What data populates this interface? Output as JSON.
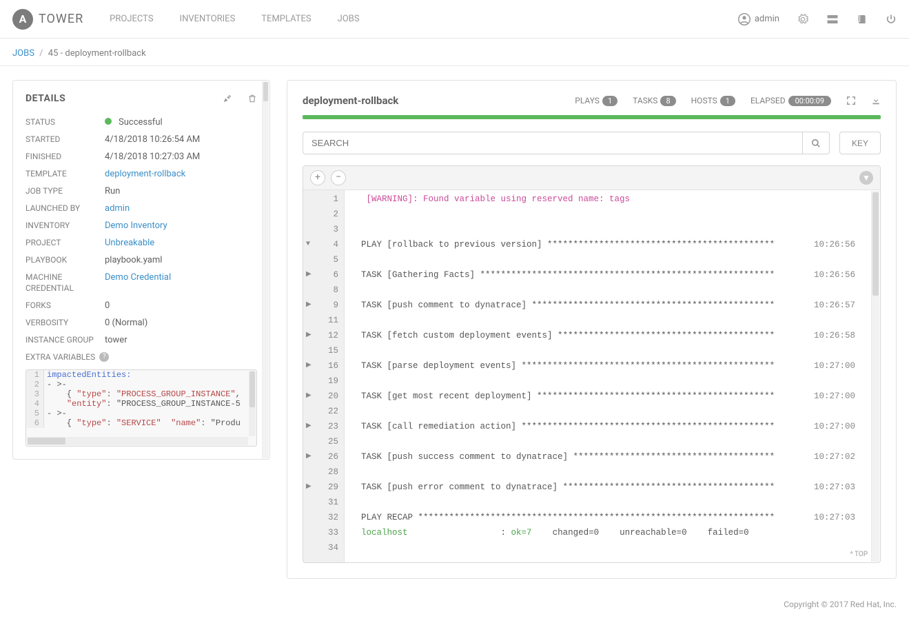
{
  "brand": "TOWER",
  "nav": [
    "PROJECTS",
    "INVENTORIES",
    "TEMPLATES",
    "JOBS"
  ],
  "user": "admin",
  "breadcrumb": {
    "root": "JOBS",
    "current": "45 - deployment-rollback"
  },
  "details": {
    "heading": "DETAILS",
    "status_label": "STATUS",
    "status_value": "Successful",
    "started_label": "STARTED",
    "started_value": "4/18/2018 10:26:54 AM",
    "finished_label": "FINISHED",
    "finished_value": "4/18/2018 10:27:03 AM",
    "template_label": "TEMPLATE",
    "template_value": "deployment-rollback",
    "jobtype_label": "JOB TYPE",
    "jobtype_value": "Run",
    "launched_label": "LAUNCHED BY",
    "launched_value": "admin",
    "inventory_label": "INVENTORY",
    "inventory_value": "Demo Inventory",
    "project_label": "PROJECT",
    "project_value": "Unbreakable",
    "playbook_label": "PLAYBOOK",
    "playbook_value": "playbook.yaml",
    "cred_label": "MACHINE CREDENTIAL",
    "cred_value": "Demo Credential",
    "forks_label": "FORKS",
    "forks_value": "0",
    "verbosity_label": "VERBOSITY",
    "verbosity_value": "0 (Normal)",
    "instance_label": "INSTANCE GROUP",
    "instance_value": "tower",
    "extravars_label": "EXTRA VARIABLES",
    "extravars_lines": [
      "impactedEntities:",
      "- >-",
      "    { \"type\": \"PROCESS_GROUP_INSTANCE\",",
      "    \"entity\": \"PROCESS_GROUP_INSTANCE-5",
      "- >-",
      "    { \"type\": \"SERVICE\"  \"name\": \"Produ"
    ]
  },
  "job": {
    "title": "deployment-rollback",
    "plays_label": "PLAYS",
    "plays": "1",
    "tasks_label": "TASKS",
    "tasks": "8",
    "hosts_label": "HOSTS",
    "hosts": "1",
    "elapsed_label": "ELAPSED",
    "elapsed": "00:00:09",
    "search_placeholder": "SEARCH",
    "key_label": "KEY",
    "scrolltop": "^ TOP"
  },
  "output": [
    {
      "n": 1,
      "toggle": "",
      "text": " [WARNING]: Found variable using reserved name: tags",
      "cls": "warn",
      "ts": ""
    },
    {
      "n": 2,
      "toggle": "",
      "text": "",
      "ts": ""
    },
    {
      "n": 3,
      "toggle": "",
      "text": "",
      "ts": ""
    },
    {
      "n": 4,
      "toggle": "v",
      "text": "PLAY [rollback to previous version] ********************************************",
      "ts": "10:26:56"
    },
    {
      "n": 5,
      "toggle": "",
      "text": "",
      "ts": ""
    },
    {
      "n": 6,
      "toggle": ">",
      "text": "TASK [Gathering Facts] *********************************************************",
      "ts": "10:26:56"
    },
    {
      "n": 8,
      "toggle": "",
      "text": "",
      "ts": ""
    },
    {
      "n": 9,
      "toggle": ">",
      "text": "TASK [push comment to dynatrace] ***********************************************",
      "ts": "10:26:57"
    },
    {
      "n": 11,
      "toggle": "",
      "text": "",
      "ts": ""
    },
    {
      "n": 12,
      "toggle": ">",
      "text": "TASK [fetch custom deployment events] ******************************************",
      "ts": "10:26:58"
    },
    {
      "n": 15,
      "toggle": "",
      "text": "",
      "ts": ""
    },
    {
      "n": 16,
      "toggle": ">",
      "text": "TASK [parse deployment events] *************************************************",
      "ts": "10:27:00"
    },
    {
      "n": 19,
      "toggle": "",
      "text": "",
      "ts": ""
    },
    {
      "n": 20,
      "toggle": ">",
      "text": "TASK [get most recent deployment] **********************************************",
      "ts": "10:27:00"
    },
    {
      "n": 22,
      "toggle": "",
      "text": "",
      "ts": ""
    },
    {
      "n": 23,
      "toggle": ">",
      "text": "TASK [call remediation action] *************************************************",
      "ts": "10:27:00"
    },
    {
      "n": 25,
      "toggle": "",
      "text": "",
      "ts": ""
    },
    {
      "n": 26,
      "toggle": ">",
      "text": "TASK [push success comment to dynatrace] ***************************************",
      "ts": "10:27:02"
    },
    {
      "n": 28,
      "toggle": "",
      "text": "",
      "ts": ""
    },
    {
      "n": 29,
      "toggle": ">",
      "text": "TASK [push error comment to dynatrace] *****************************************",
      "ts": "10:27:03"
    },
    {
      "n": 31,
      "toggle": "",
      "text": "",
      "ts": ""
    },
    {
      "n": 32,
      "toggle": "",
      "text": "PLAY RECAP *********************************************************************",
      "ts": "10:27:03"
    },
    {
      "n": 33,
      "toggle": "",
      "recap": true,
      "host": "localhost",
      "ok": "ok=7",
      "rest": "    changed=0    unreachable=0    failed=0",
      "ts": ""
    },
    {
      "n": 34,
      "toggle": "",
      "text": "",
      "ts": ""
    }
  ],
  "footer": "Copyright © 2017 Red Hat, Inc."
}
